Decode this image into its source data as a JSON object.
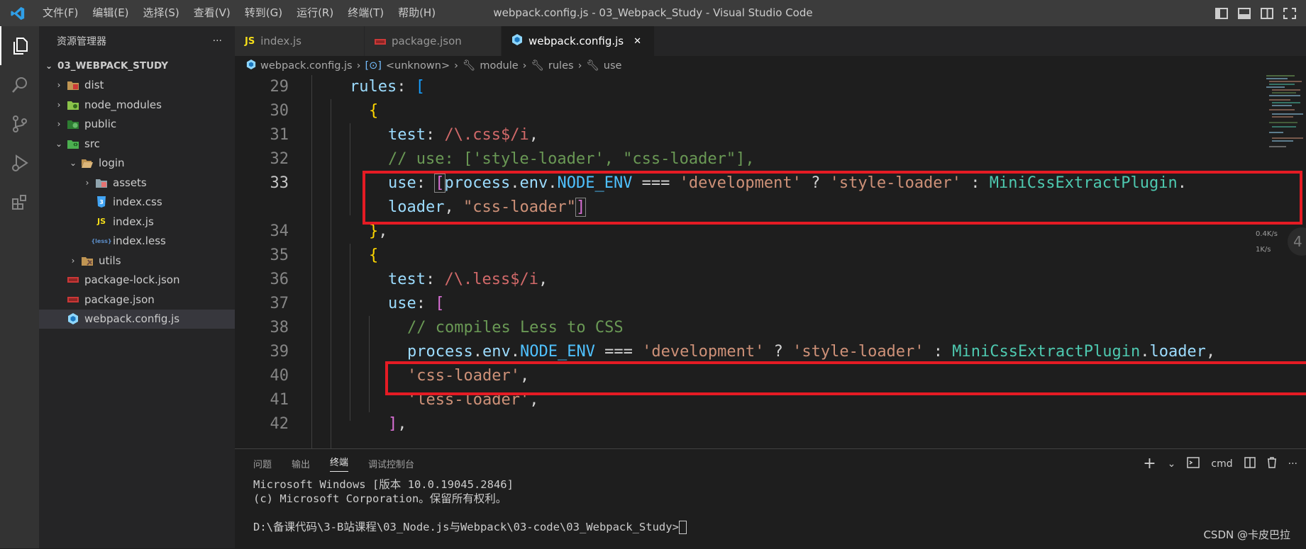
{
  "titlebar": {
    "menu": [
      "文件(F)",
      "编辑(E)",
      "选择(S)",
      "查看(V)",
      "转到(G)",
      "运行(R)",
      "终端(T)",
      "帮助(H)"
    ],
    "title": "webpack.config.js - 03_Webpack_Study - Visual Studio Code"
  },
  "sidebar": {
    "header": "资源管理器",
    "more": "···",
    "root": "03_WEBPACK_STUDY",
    "items": [
      {
        "label": "dist",
        "icon": "folder-dist-icon"
      },
      {
        "label": "node_modules",
        "icon": "folder-node-icon"
      },
      {
        "label": "public",
        "icon": "folder-public-icon"
      },
      {
        "label": "src",
        "icon": "folder-src-icon"
      },
      {
        "label": "login",
        "icon": "folder-open-icon"
      },
      {
        "label": "assets",
        "icon": "folder-assets-icon"
      },
      {
        "label": "index.css",
        "icon": "css-file-icon"
      },
      {
        "label": "index.js",
        "icon": "js-file-icon"
      },
      {
        "label": "index.less",
        "icon": "less-file-icon"
      },
      {
        "label": "utils",
        "icon": "folder-utils-icon"
      },
      {
        "label": "package-lock.json",
        "icon": "npm-file-icon"
      },
      {
        "label": "package.json",
        "icon": "npm-file-icon"
      },
      {
        "label": "webpack.config.js",
        "icon": "webpack-file-icon"
      }
    ]
  },
  "tabs": [
    {
      "label": "index.js",
      "badge": "JS"
    },
    {
      "label": "package.json",
      "badge": ""
    },
    {
      "label": "webpack.config.js",
      "badge": "",
      "close": "✕"
    }
  ],
  "breadcrumbs": [
    "webpack.config.js",
    "<unknown>",
    "module",
    "rules",
    "use"
  ],
  "line_numbers": [
    "29",
    "30",
    "31",
    "32",
    "33",
    "",
    "34",
    "35",
    "36",
    "37",
    "38",
    "39",
    "40",
    "41",
    "42"
  ],
  "code": {
    "l29a": "rules",
    "l29b": ": ",
    "l29c": "[",
    "l30": "{",
    "l31a": "test",
    "l31b": ": ",
    "l31c": "/\\.css$/i",
    "l31d": ",",
    "l32": "// use: ['style-loader', \"css-loader\"],",
    "l33a": "use",
    "l33b": ": ",
    "l33c": "[",
    "l33d": "process",
    "l33e": ".",
    "l33f": "env",
    "l33g": ".",
    "l33h": "NODE_ENV",
    "l33i": " === ",
    "l33j": "'development'",
    "l33k": " ? ",
    "l33l": "'style-loader'",
    "l33m": " : ",
    "l33n": "MiniCssExtractPlugin",
    "l33o": ".",
    "l33wa": "loader",
    "l33wb": ", ",
    "l33wc": "\"css-loader\"",
    "l33wd": "]",
    "l34a": "}",
    "l34b": ",",
    "l35": "{",
    "l36a": "test",
    "l36b": ": ",
    "l36c": "/\\.less$/i",
    "l36d": ",",
    "l37a": "use",
    "l37b": ": ",
    "l37c": "[",
    "l38": "// compiles Less to CSS",
    "l39a": "process",
    "l39b": ".",
    "l39c": "env",
    "l39d": ".",
    "l39e": "NODE_ENV",
    "l39f": " === ",
    "l39g": "'development'",
    "l39h": " ? ",
    "l39i": "'style-loader'",
    "l39j": " : ",
    "l39k": "MiniCssExtractPlugin",
    "l39l": ".",
    "l39m": "loader",
    "l39n": ",",
    "l40a": "'css-loader'",
    "l40b": ",",
    "l41a": "'less-loader'",
    "l41b": ",",
    "l42a": "]",
    "l42b": ","
  },
  "speed": {
    "up": "0.4K/s",
    "down": "1K/s",
    "side": "4"
  },
  "panel": {
    "tabs": [
      "问题",
      "输出",
      "终端",
      "调试控制台"
    ],
    "active_tab": "终端",
    "actions": {
      "add": "+",
      "dropdown": "⌄",
      "shell": "cmd"
    },
    "terminal": [
      "Microsoft Windows [版本 10.0.19045.2846]",
      "(c) Microsoft Corporation。保留所有权利。",
      "",
      "D:\\备课代码\\3-B站课程\\03_Node.js与Webpack\\03-code\\03_Webpack_Study>"
    ]
  },
  "watermark": "CSDN @卡皮巴拉",
  "colors": {
    "accent": "#007acc",
    "highlight_box": "#e51b24"
  }
}
